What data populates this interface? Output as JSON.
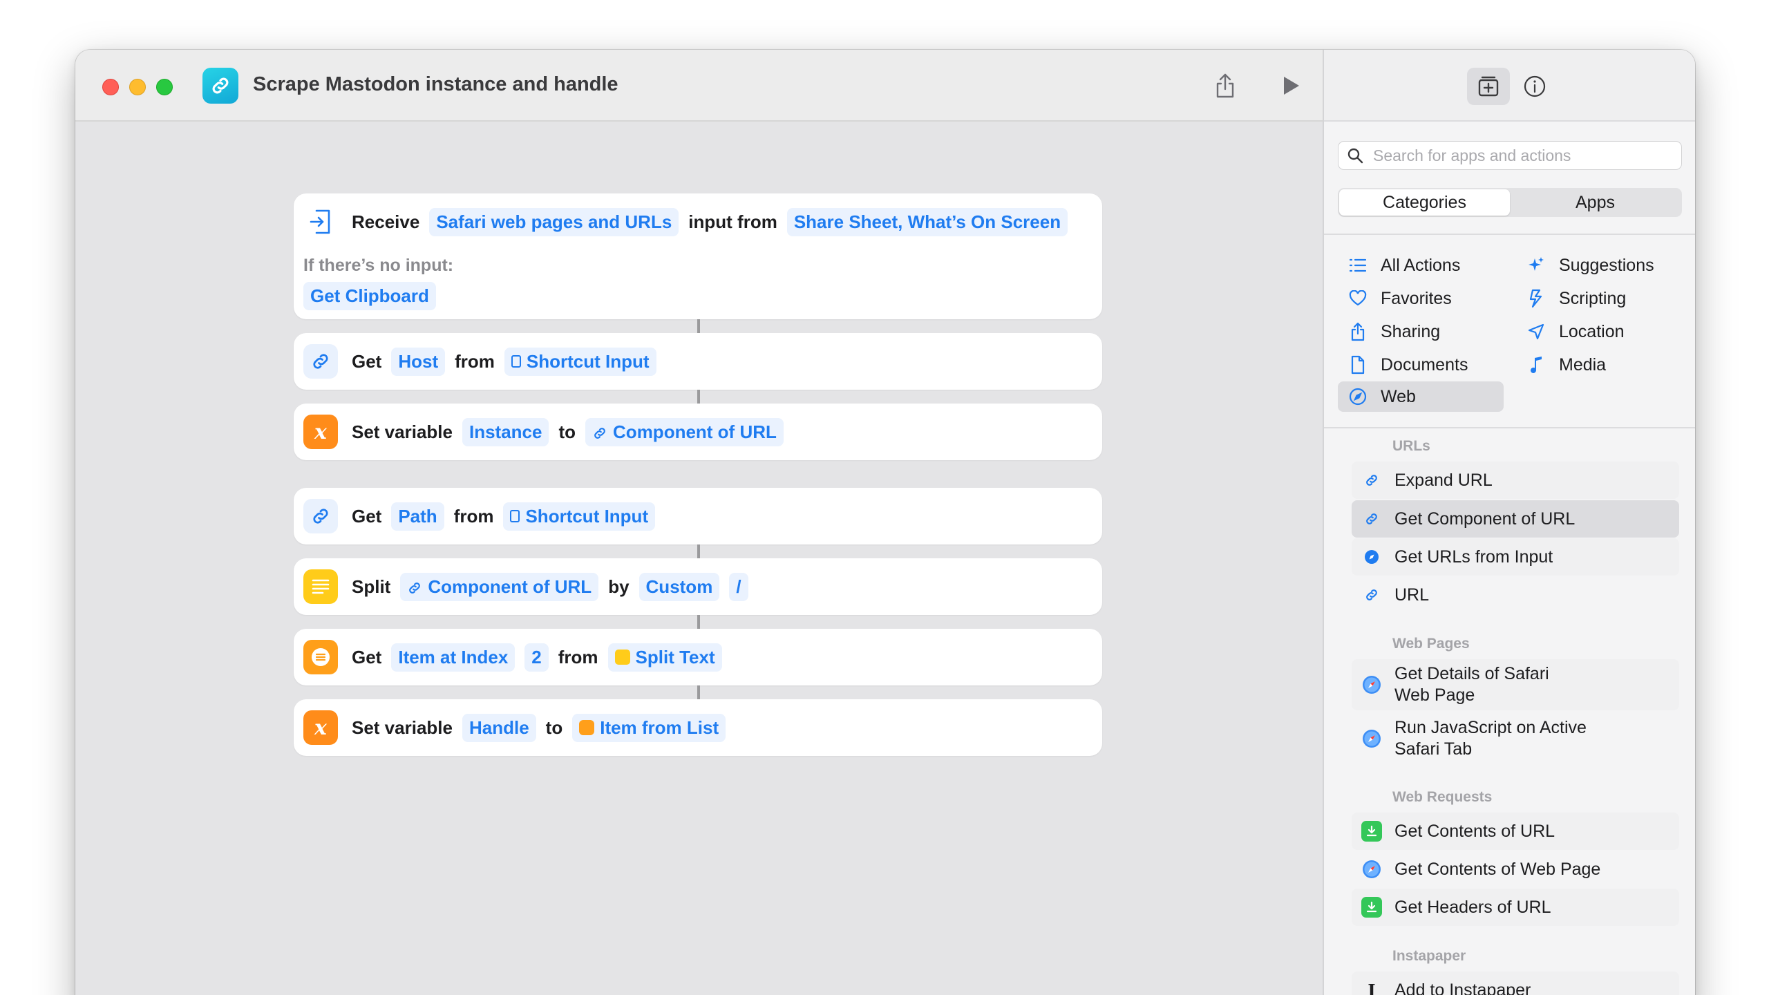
{
  "window": {
    "title": "Scrape Mastodon instance and handle",
    "accent": "#1f7cf0"
  },
  "actions": {
    "receive": {
      "w1": "Receive",
      "t1": "Safari web pages and URLs",
      "w2": "input from",
      "t2": "Share Sheet, What’s On Screen",
      "no_input_label": "If there’s no input:",
      "fallback": "Get Clipboard"
    },
    "get_host": {
      "w1": "Get",
      "t1": "Host",
      "w2": "from",
      "t2": "Shortcut Input"
    },
    "set_instance": {
      "w1": "Set variable",
      "t1": "Instance",
      "w2": "to",
      "t2": "Component of URL"
    },
    "get_path": {
      "w1": "Get",
      "t1": "Path",
      "w2": "from",
      "t2": "Shortcut Input"
    },
    "split": {
      "w1": "Split",
      "t1": "Component of URL",
      "w2": "by",
      "t2": "Custom",
      "t3": "/"
    },
    "get_item": {
      "w1": "Get",
      "t1": "Item at Index",
      "t2": "2",
      "w2": "from",
      "t3": "Split Text"
    },
    "set_handle": {
      "w1": "Set variable",
      "t1": "Handle",
      "w2": "to",
      "t2": "Item from List"
    }
  },
  "sidebar": {
    "search_placeholder": "Search for apps and actions",
    "segments": [
      "Categories",
      "Apps"
    ],
    "categories": [
      {
        "label": "All Actions",
        "icon": "list-icon"
      },
      {
        "label": "Suggestions",
        "icon": "sparkle-icon"
      },
      {
        "label": "Favorites",
        "icon": "heart-icon"
      },
      {
        "label": "Scripting",
        "icon": "scripting-icon"
      },
      {
        "label": "Sharing",
        "icon": "share-icon"
      },
      {
        "label": "Location",
        "icon": "location-arrow-icon"
      },
      {
        "label": "Documents",
        "icon": "document-icon"
      },
      {
        "label": "Media",
        "icon": "music-note-icon"
      },
      {
        "label": "Web",
        "icon": "compass-icon"
      }
    ],
    "sections": {
      "urls": "URLs",
      "web_pages": "Web Pages",
      "web_requests": "Web Requests",
      "instapaper": "Instapaper"
    },
    "items": {
      "expand_url": "Expand URL",
      "get_component": "Get Component of URL",
      "get_urls_input": "Get URLs from Input",
      "url": "URL",
      "get_details_1": "Get Details of Safari",
      "get_details_2": "Web Page",
      "run_js_1": "Run JavaScript on Active",
      "run_js_2": "Safari Tab",
      "get_contents_url": "Get Contents of URL",
      "get_contents_page": "Get Contents of Web Page",
      "get_headers": "Get Headers of URL",
      "add_instapaper": "Add to Instapaper"
    }
  }
}
